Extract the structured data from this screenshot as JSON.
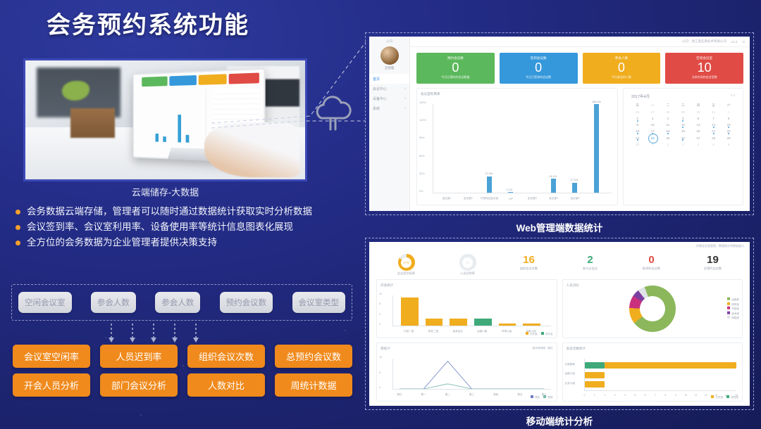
{
  "slide": {
    "title": "会务预约系统功能",
    "photo_caption": "云端储存-大数据",
    "bullets": [
      "会务数据云端存储，管理者可以随时通过数据统计获取实时分析数据",
      "会议签到率、会议室利用率、设备使用率等统计信息图表化展现",
      "全方位的会务数据为企业管理者提供决策支持"
    ],
    "source_tags": [
      "空闲会议室",
      "参会人数",
      "参会人数",
      "预约会议数",
      "会议室类型"
    ],
    "output_tags": [
      "会议室空闲率",
      "人员迟到率",
      "组织会议次数",
      "总预约会议数",
      "开会人员分析",
      "部门会议分析",
      "人数对比",
      "周统计数据"
    ],
    "caption_web": "Web管理端数据统计",
    "caption_mobile": "移动端统计分析"
  },
  "web_app": {
    "sidebar": {
      "brand": "公司",
      "user_name": "王经理",
      "items": [
        {
          "label": "首页",
          "active": true,
          "chevron": ""
        },
        {
          "label": "会议中心",
          "active": false,
          "chevron": "›"
        },
        {
          "label": "设备中心",
          "active": false,
          "chevron": "›"
        },
        {
          "label": "系统",
          "active": false,
          "chevron": "›"
        }
      ]
    },
    "topbar": {
      "welcome": "公司：浙江某信息技术有限公司",
      "version": "v1.0",
      "logout": "⏻"
    },
    "kpis": [
      {
        "title": "预约会议数",
        "value": "0",
        "sub": "今日已预约的会议数量",
        "color": "#5cb85c"
      },
      {
        "title": "签到会议数",
        "value": "0",
        "sub": "今日已签到的会议数",
        "color": "#3598db"
      },
      {
        "title": "参会人数",
        "value": "0",
        "sub": "今日参会的人数",
        "color": "#f0ad1e"
      },
      {
        "title": "空闲会议室",
        "value": "10",
        "sub": "当前空闲的会议室数",
        "color": "#e04b45"
      }
    ],
    "chart_card_title": "会议室利用率",
    "calendar": {
      "month_label": "2017年4月",
      "nav": "‹ ›",
      "weekdays": [
        "日",
        "一",
        "二",
        "三",
        "四",
        "五",
        "六"
      ],
      "selected_day": 24,
      "marked_days": [
        1,
        2,
        5,
        12,
        14,
        15,
        16,
        17,
        18,
        21,
        22,
        23,
        26
      ]
    }
  },
  "mobile_app": {
    "header_note": "所属会议室管理，数据统计的数据展示",
    "stats": [
      {
        "type": "ring",
        "value": "17%",
        "label": "会议室空闲率",
        "color": "#f0ad1e"
      },
      {
        "type": "ring",
        "value": "0%",
        "label": "人员迟到率",
        "color": "#dfe3e8"
      },
      {
        "type": "num",
        "value": "16",
        "label": "组织会议次数",
        "color": "#f0ad1e"
      },
      {
        "type": "num",
        "value": "2",
        "label": "参与过会议",
        "color": "#3fa97a"
      },
      {
        "type": "num",
        "value": "0",
        "label": "取消的会议数",
        "color": "#e04b45"
      },
      {
        "type": "num",
        "value": "19",
        "label": "总预约会议数",
        "color": "#333333"
      }
    ],
    "cards": {
      "bar_title": "开会统计",
      "donut_title": "人员对比",
      "line_title": "周统计",
      "line_note": "统计时间段：周日",
      "hbar_title": "会议次数统计"
    }
  },
  "chart_data": [
    {
      "type": "bar",
      "title": "会议室利用率",
      "categories": [
        "会议室1",
        "会议室2",
        "可视电话会议室",
        "VIP",
        "会议室3",
        "会议室4",
        "会议室5"
      ],
      "values": [
        0,
        0,
        27.9,
        1.1,
        0,
        24.1,
        17.0
      ],
      "extra_value": 150.0,
      "data_labels": [
        "27.9%",
        "1.1%",
        "24.1%",
        "17.0%",
        "150.0%"
      ],
      "ylabel": "",
      "yticks": [
        "0%",
        "30%",
        "60%",
        "90%",
        "120%",
        "150%"
      ],
      "ylim": [
        0,
        150
      ],
      "grid": false,
      "color": "#4ba2d6"
    },
    {
      "type": "bar",
      "title": "开会统计",
      "categories": [
        "行政一室",
        "研发二室",
        "技术会议",
        "运营小组",
        "市场小组",
        "运维小组"
      ],
      "series": [
        {
          "name": "已开会",
          "values": [
            12,
            3,
            3,
            0,
            1,
            1
          ],
          "color": "#f0ad1e"
        },
        {
          "name": "未开会",
          "values": [
            0,
            0,
            0,
            3,
            0,
            0
          ],
          "color": "#3fa97a"
        }
      ],
      "yticks": [
        "0",
        "4",
        "8",
        "12"
      ],
      "ylim": [
        0,
        13
      ],
      "legend": [
        "已开会",
        "未开会"
      ]
    },
    {
      "type": "pie",
      "title": "人员对比",
      "labels": [
        "运维部",
        "研发部",
        "市场部",
        "技术部",
        "网络部"
      ],
      "values": [
        70,
        11,
        9,
        5,
        5
      ],
      "colors": [
        "#8cb75b",
        "#f0ad1e",
        "#c9307e",
        "#7b3fa0",
        "#dfe3e8"
      ],
      "legend_position": "right"
    },
    {
      "type": "line",
      "title": "周统计",
      "categories": [
        "周日",
        "周一",
        "周二",
        "周三",
        "周四",
        "周五",
        "周六"
      ],
      "series": [
        {
          "name": "预约",
          "values": [
            0,
            0,
            11,
            0,
            0,
            0,
            0
          ],
          "color": "#6f7fc4"
        },
        {
          "name": "签到",
          "values": [
            0,
            0,
            2,
            0,
            0,
            0,
            0
          ],
          "color": "#76b7a8"
        }
      ],
      "yticks": [
        "0",
        "6",
        "12"
      ],
      "ylim": [
        0,
        12
      ],
      "legend": [
        "预约",
        "签到"
      ]
    },
    {
      "type": "bar",
      "title": "会议次数统计",
      "orientation": "horizontal",
      "categories": [
        "行政部室",
        "运维小组",
        "业务小组"
      ],
      "series": [
        {
          "name": "已完成",
          "values": [
            13,
            2,
            2
          ],
          "color": "#f0ad1e"
        },
        {
          "name": "未完成",
          "values": [
            2,
            0,
            0
          ],
          "color": "#3fa97a"
        }
      ],
      "xticks": [
        "0",
        "1",
        "2",
        "3",
        "4",
        "5",
        "6",
        "7",
        "8",
        "9",
        "10",
        "11",
        "12",
        "13",
        "14",
        "15"
      ],
      "xlim": [
        0,
        15
      ],
      "legend": [
        "已完成",
        "未完成"
      ]
    }
  ]
}
